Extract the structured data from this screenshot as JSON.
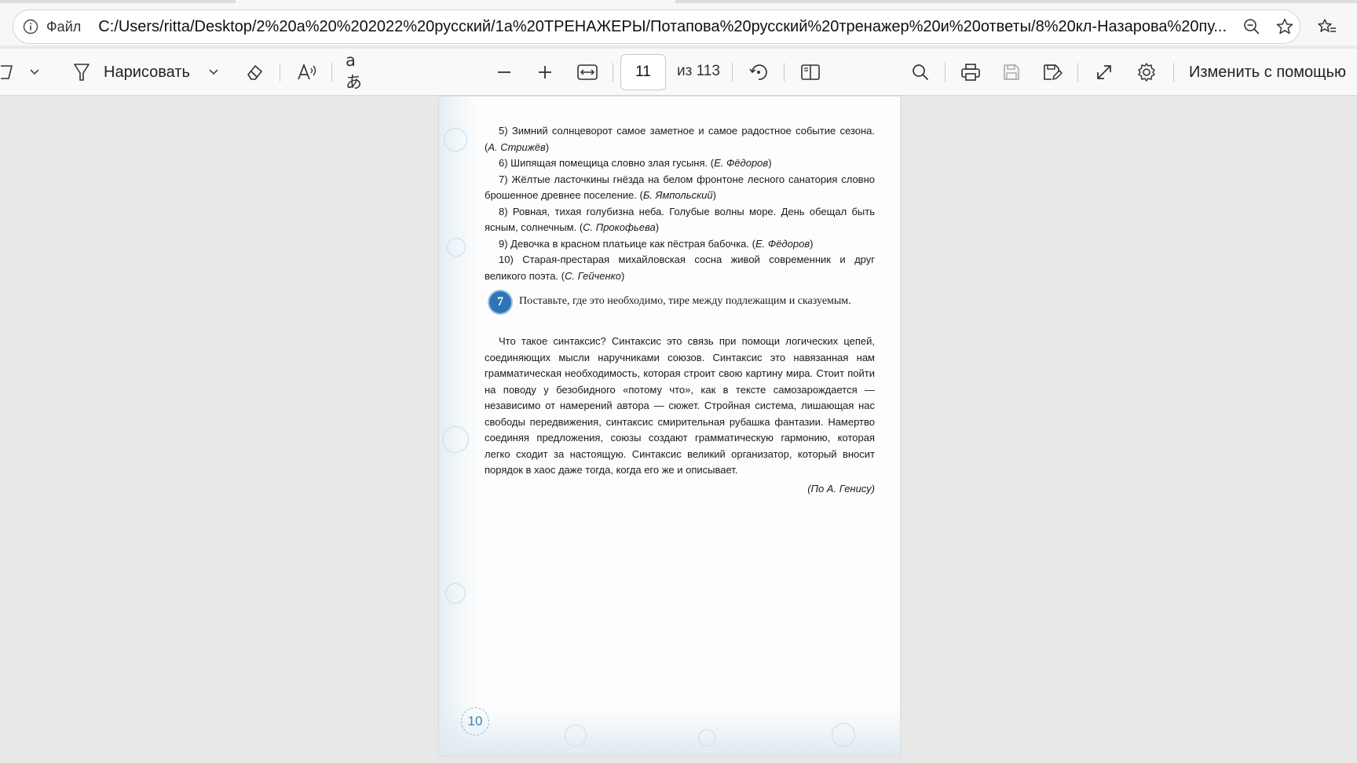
{
  "browser": {
    "scheme_label": "Файл",
    "url": "C:/Users/ritta/Desktop/2%20а%20%202022%20русский/1а%20ТРЕНАЖЕРЫ/Потапова%20русский%20тренажер%20и%20ответы/8%20кл-Назарова%20пу..."
  },
  "toolbar": {
    "draw_label": "Нарисовать",
    "page_current": "11",
    "page_total": "из 113",
    "edit_with_label": "Изменить с помощью"
  },
  "pdf": {
    "sentences": [
      {
        "text": "5) Зимний солнцеворот самое заметное и самое радостное событие сезона. (",
        "author": "А. Стрижёв",
        "close": ")"
      },
      {
        "text": "6) Шипящая помещица словно злая гусыня. (",
        "author": "Е. Фёдоров",
        "close": ")"
      },
      {
        "text": "7) Жёлтые ласточкины гнёзда на белом фронтоне лесного санатория словно брошенное древнее поселение. (",
        "author": "Б. Ямпольский",
        "close": ")"
      },
      {
        "text": "8) Ровная, тихая голубизна неба. Голубые волны море. День обещал быть ясным, солнечным. (",
        "author": "С. Прокофьева",
        "close": ")"
      },
      {
        "text": "9) Девочка в красном платьице как пёстрая бабочка. (",
        "author": "Е. Фёдоров",
        "close": ")"
      },
      {
        "text": "10) Старая-престарая михайловская сосна живой современник и друг великого поэта. (",
        "author": "С. Гейченко",
        "close": ")"
      }
    ],
    "task_number": "7",
    "task_title": "Поставьте, где это необходимо, тире между подлежащим и сказуемым.",
    "passage": "Что такое синтаксис? Синтаксис это связь при помощи логических цепей, соединяющих мысли наручниками союзов. Синтаксис это навязанная нам грамматическая необходимость, которая строит свою картину мира. Стоит пойти на поводу у безобидного «потому что», как в тексте самозарождается — независимо от намерений автора — сюжет. Стройная система, лишающая нас свободы передвижения, синтаксис смирительная рубашка фантазии. Намертво соединяя предложения, союзы создают грамматическую гармонию, которая легко сходит за настоящую. Синтаксис великий организатор, который вносит порядок в хаос даже тогда, когда его же и описывает.",
    "passage_author": "(По А. Генису)",
    "page_number": "10"
  }
}
